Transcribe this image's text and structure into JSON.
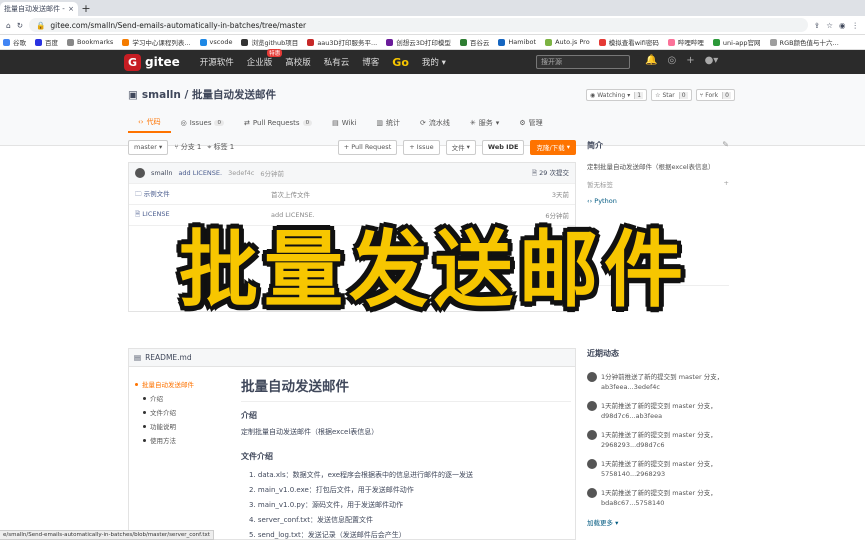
{
  "browser": {
    "tab_title": "批量自动发送邮件 - 码云",
    "new_tab_symbol": "+",
    "url": "gitee.com/smalln/Send-emails-automatically-in-batches/tree/master",
    "bookmarks": [
      {
        "label": "谷歌",
        "color": "#4285f4"
      },
      {
        "label": "百度",
        "color": "#2932e1"
      },
      {
        "label": "Bookmarks",
        "color": "#888888"
      },
      {
        "label": "学习中心课程列表...",
        "color": "#f57c00"
      },
      {
        "label": "vscode",
        "color": "#1e88e5"
      },
      {
        "label": "浏览github项目",
        "color": "#333333"
      },
      {
        "label": "aau3D打印服务平...",
        "color": "#c62828"
      },
      {
        "label": "创想云3D打印模型",
        "color": "#6a1b9a"
      },
      {
        "label": "百谷云",
        "color": "#2e7d32"
      },
      {
        "label": "Hamibot",
        "color": "#1565c0"
      },
      {
        "label": "Auto.js Pro",
        "color": "#7cb342"
      },
      {
        "label": "模拟查看wifi密码",
        "color": "#e53935"
      },
      {
        "label": "哔哩哔哩",
        "color": "#fb7299"
      },
      {
        "label": "uni-app官网",
        "color": "#2b9939"
      },
      {
        "label": "RGB颜色值与十六...",
        "color": "#9e9e9e"
      }
    ]
  },
  "gitee_nav": {
    "logo_letter": "G",
    "logo_text": "gitee",
    "items": [
      "开源软件",
      "企业版",
      "高校版",
      "私有云",
      "博客"
    ],
    "enterprise_badge": "特惠",
    "go_label": "Go",
    "mine_label": "我的",
    "search_placeholder": "搜开源",
    "icons": [
      "bell-icon",
      "location-icon",
      "plus-icon",
      "user-avatar"
    ]
  },
  "repo": {
    "title": "smalln / 批量自动发送邮件",
    "watching_label": "Watching",
    "watching_count": "1",
    "star_label": "Star",
    "star_count": "0",
    "fork_label": "Fork",
    "fork_count": "0",
    "tabs": [
      {
        "label": "代码",
        "count": "",
        "active": true
      },
      {
        "label": "Issues",
        "count": "0",
        "active": false
      },
      {
        "label": "Pull Requests",
        "count": "0",
        "active": false
      },
      {
        "label": "Wiki",
        "count": "",
        "active": false
      },
      {
        "label": "统计",
        "count": "",
        "active": false
      },
      {
        "label": "流水线",
        "count": "",
        "active": false
      },
      {
        "label": "服务",
        "count": "",
        "active": false
      },
      {
        "label": "管理",
        "count": "",
        "active": false
      }
    ]
  },
  "code": {
    "branch": "master",
    "branches": "分支 1",
    "tags": "标签 1",
    "pull_request_btn": "+ Pull Request",
    "issue_btn": "+ Issue",
    "file_btn": "文件",
    "webide_btn": "Web IDE",
    "clone_btn": "克隆/下载",
    "last_commit": {
      "author": "smalln",
      "message": "add LICENSE.",
      "hash": "3edef4c",
      "time": "6分钟前",
      "commits": "29 次提交"
    },
    "files": [
      {
        "name": "示例文件",
        "message": "首次上传文件",
        "date": "3天前"
      },
      {
        "name": "LICENSE",
        "message": "add LICENSE.",
        "date": "6分钟前"
      }
    ]
  },
  "sidebar": {
    "intro_title": "简介",
    "intro_text": "定制批量自动发送邮件（根据excel表信息）",
    "tags_label": "暂无标签",
    "language": "Python"
  },
  "readme": {
    "filename": "README.md",
    "toc": [
      {
        "label": "批量自动发送邮件",
        "active": true
      },
      {
        "label": "介绍",
        "active": false
      },
      {
        "label": "文件介绍",
        "active": false
      },
      {
        "label": "功能说明",
        "active": false
      },
      {
        "label": "使用方法",
        "active": false
      }
    ],
    "h1": "批量自动发送邮件",
    "intro_heading": "介绍",
    "intro_text": "定制批量自动发送邮件（根据excel表信息）",
    "files_heading": "文件介绍",
    "files": [
      "1. data.xls：数据文件，exe程序会根据表中的信息进行邮件的逐一发送",
      "2. main_v1.0.exe：打包后文件，用于发送邮件动作",
      "3. main_v1.0.py：源码文件，用于发送邮件动作",
      "4. server_conf.txt：发送信息配置文件",
      "5. send_log.txt：发送记录（发送邮件后会产生）"
    ]
  },
  "activity": {
    "title": "近期动态",
    "items": [
      {
        "text": "1分钟前推送了新的提交到 master 分支，ab3feea...3edef4c"
      },
      {
        "text": "1天前推送了新的提交到 master 分支，d98d7c6...ab3feea"
      },
      {
        "text": "1天前推送了新的提交到 master 分支，2968293...d98d7c6"
      },
      {
        "text": "1天前推送了新的提交到 master 分支，5758140...2968293"
      },
      {
        "text": "1天前推送了新的提交到 master 分支，bda8c67...5758140"
      }
    ],
    "load_more": "加载更多"
  },
  "status_url": "e/smalln/Send-emails-automatically-in-batches/blob/master/server_conf.txt",
  "overlay_text": "批量发送邮件"
}
